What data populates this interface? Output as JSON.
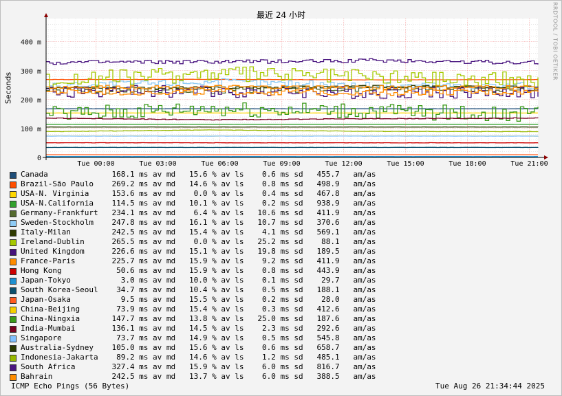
{
  "watermark": "RRDTOOL / TOBI OETIKER",
  "footer": {
    "probe": "ICMP Echo Pings (56 Bytes)",
    "timestamp": "Tue Aug 26 21:34:44 2025"
  },
  "colors": {
    "background": "#f3f3f3",
    "plot_background": "#ffffff",
    "major_grid": "#ff9b9b",
    "minor_grid": "#d0d0d0",
    "axis": "#000000",
    "arrow": "#8b0000"
  },
  "chart_data": {
    "type": "line",
    "title": "最近 24 小时",
    "ylabel": "Seconds",
    "ylim": [
      0,
      480
    ],
    "yticks": [
      {
        "value": 0,
        "label": "0"
      },
      {
        "value": 100,
        "label": "100 m"
      },
      {
        "value": 200,
        "label": "200 m"
      },
      {
        "value": 300,
        "label": "300 m"
      },
      {
        "value": 400,
        "label": "400 m"
      }
    ],
    "xlim": [
      "Mon 22:00",
      "Tue 21:40"
    ],
    "xticks": [
      {
        "value": "Tue 00:00",
        "label": "Tue 00:00"
      },
      {
        "value": "Tue 03:00",
        "label": "Tue 03:00"
      },
      {
        "value": "Tue 06:00",
        "label": "Tue 06:00"
      },
      {
        "value": "Tue 09:00",
        "label": "Tue 09:00"
      },
      {
        "value": "Tue 12:00",
        "label": "Tue 12:00"
      },
      {
        "value": "Tue 15:00",
        "label": "Tue 15:00"
      },
      {
        "value": "Tue 18:00",
        "label": "Tue 18:00"
      },
      {
        "value": "Tue 21:00",
        "label": "Tue 21:00"
      }
    ],
    "grid": true,
    "legend_placement": "bottom",
    "series": [
      {
        "name": "Canada",
        "color": "#1f4e79",
        "values_ms": [
          168.1,
          168.1,
          168.1,
          168.1
        ],
        "stats": {
          "median": "168.1 ms av md",
          "loss": "15.6 % av ls",
          "sd": "0.6 ms sd",
          "am": "455.7",
          "am_unit": "am/as"
        }
      },
      {
        "name": "Brazil-São Paulo",
        "color": "#ff4e00",
        "values_ms": [
          269.2,
          270,
          268,
          269.2
        ],
        "stats": {
          "median": "269.2 ms av md",
          "loss": "14.6 % av ls",
          "sd": "0.8 ms sd",
          "am": "498.9",
          "am_unit": "am/as"
        }
      },
      {
        "name": "USA-N. Virginia",
        "color": "#ffd700",
        "values_ms": [
          153.6,
          153.6,
          153.6,
          153.6
        ],
        "stats": {
          "median": "153.6 ms av md",
          "loss": "0.0 % av ls",
          "sd": "0.4 ms sd",
          "am": "467.8",
          "am_unit": "am/as"
        }
      },
      {
        "name": "USA-N.California",
        "color": "#32a02d",
        "values_ms": [
          114.5,
          114.5,
          114.5,
          114.5
        ],
        "stats": {
          "median": "114.5 ms av md",
          "loss": "10.1 % av ls",
          "sd": "0.2 ms sd",
          "am": "938.9",
          "am_unit": "am/as"
        }
      },
      {
        "name": "Germany-Frankfurt",
        "color": "#556b2f",
        "values_ms": [
          234.1,
          232,
          240,
          234.1
        ],
        "stats": {
          "median": "234.1 ms av md",
          "loss": "6.4 % av ls",
          "sd": "10.6 ms sd",
          "am": "411.9",
          "am_unit": "am/as"
        }
      },
      {
        "name": "Sweden-Stockholm",
        "color": "#8ecbf5",
        "values_ms": [
          247.8,
          262,
          250,
          247.8
        ],
        "stats": {
          "median": "247.8 ms av md",
          "loss": "16.1 % av ls",
          "sd": "10.7 ms sd",
          "am": "370.6",
          "am_unit": "am/as"
        }
      },
      {
        "name": "Italy-Milan",
        "color": "#2f3a00",
        "values_ms": [
          242.5,
          240,
          245,
          242.5
        ],
        "stats": {
          "median": "242.5 ms av md",
          "loss": "15.4 % av ls",
          "sd": "4.1 ms sd",
          "am": "569.1",
          "am_unit": "am/as"
        }
      },
      {
        "name": "Ireland-Dublin",
        "color": "#a5c800",
        "values_ms": [
          265.5,
          290,
          280,
          265.5
        ],
        "stats": {
          "median": "265.5 ms av md",
          "loss": "0.0 % av ls",
          "sd": "25.2 ms sd",
          "am": "88.1",
          "am_unit": "am/as"
        }
      },
      {
        "name": "United Kingdom",
        "color": "#46127a",
        "values_ms": [
          226.6,
          230,
          225,
          226.6
        ],
        "stats": {
          "median": "226.6 ms av md",
          "loss": "15.1 % av ls",
          "sd": "19.8 ms sd",
          "am": "189.5",
          "am_unit": "am/as"
        }
      },
      {
        "name": "France-Paris",
        "color": "#ff8c00",
        "values_ms": [
          225.7,
          226,
          224,
          225.7
        ],
        "stats": {
          "median": "225.7 ms av md",
          "loss": "15.9 % av ls",
          "sd": "9.2 ms sd",
          "am": "411.9",
          "am_unit": "am/as"
        }
      },
      {
        "name": "Hong Kong",
        "color": "#cc0000",
        "values_ms": [
          50.6,
          50.6,
          50.6,
          50.6
        ],
        "stats": {
          "median": "50.6 ms av md",
          "loss": "15.9 % av ls",
          "sd": "0.8 ms sd",
          "am": "443.9",
          "am_unit": "am/as"
        }
      },
      {
        "name": "Japan-Tokyo",
        "color": "#1e90d0",
        "values_ms": [
          3.0,
          3.0,
          3.0,
          3.0
        ],
        "stats": {
          "median": "3.0 ms av md",
          "loss": "10.0 % av ls",
          "sd": "0.1 ms sd",
          "am": "29.7",
          "am_unit": "am/as"
        }
      },
      {
        "name": "South Korea-Seoul",
        "color": "#0b4f6c",
        "values_ms": [
          34.7,
          34.7,
          34.7,
          34.7
        ],
        "stats": {
          "median": "34.7 ms av md",
          "loss": "10.4 % av ls",
          "sd": "0.5 ms sd",
          "am": "188.1",
          "am_unit": "am/as"
        }
      },
      {
        "name": "Japan-Osaka",
        "color": "#ff5a1f",
        "values_ms": [
          9.5,
          9.5,
          9.5,
          9.5
        ],
        "stats": {
          "median": "9.5 ms av md",
          "loss": "15.5 % av ls",
          "sd": "0.2 ms sd",
          "am": "28.0",
          "am_unit": "am/as"
        }
      },
      {
        "name": "China-Beijing",
        "color": "#f5d000",
        "values_ms": [
          73.9,
          73.9,
          73.9,
          73.9
        ],
        "stats": {
          "median": "73.9 ms av md",
          "loss": "15.4 % av ls",
          "sd": "0.3 ms sd",
          "am": "412.6",
          "am_unit": "am/as"
        }
      },
      {
        "name": "China-Ningxia",
        "color": "#3a9a1a",
        "values_ms": [
          147.7,
          170,
          160,
          147.7
        ],
        "stats": {
          "median": "147.7 ms av md",
          "loss": "13.8 % av ls",
          "sd": "25.0 ms sd",
          "am": "187.6",
          "am_unit": "am/as"
        }
      },
      {
        "name": "India-Mumbai",
        "color": "#7a0020",
        "values_ms": [
          136.1,
          130,
          134,
          136.1
        ],
        "stats": {
          "median": "136.1 ms av md",
          "loss": "14.5 % av ls",
          "sd": "2.3 ms sd",
          "am": "292.6",
          "am_unit": "am/as"
        }
      },
      {
        "name": "Singapore",
        "color": "#80c0ff",
        "values_ms": [
          73.7,
          73.7,
          73.7,
          73.7
        ],
        "stats": {
          "median": "73.7 ms av md",
          "loss": "14.9 % av ls",
          "sd": "0.5 ms sd",
          "am": "545.8",
          "am_unit": "am/as"
        }
      },
      {
        "name": "Australia-Sydney",
        "color": "#2b3a00",
        "values_ms": [
          105.0,
          105.0,
          105.0,
          105.0
        ],
        "stats": {
          "median": "105.0 ms av md",
          "loss": "15.6 % av ls",
          "sd": "0.6 ms sd",
          "am": "658.7",
          "am_unit": "am/as"
        }
      },
      {
        "name": "Indonesia-Jakarta",
        "color": "#98b800",
        "values_ms": [
          89.2,
          95,
          90,
          89.2
        ],
        "stats": {
          "median": "89.2 ms av md",
          "loss": "14.6 % av ls",
          "sd": "1.2 ms sd",
          "am": "485.1",
          "am_unit": "am/as"
        }
      },
      {
        "name": "South Africa",
        "color": "#4a1680",
        "values_ms": [
          327.4,
          330,
          335,
          327.4
        ],
        "stats": {
          "median": "327.4 ms av md",
          "loss": "15.9 % av ls",
          "sd": "6.0 ms sd",
          "am": "816.7",
          "am_unit": "am/as"
        }
      },
      {
        "name": "Bahrain",
        "color": "#ff8c00",
        "values_ms": [
          242.5,
          243,
          242,
          242.5
        ],
        "stats": {
          "median": "242.5 ms av md",
          "loss": "13.7 % av ls",
          "sd": "6.0 ms sd",
          "am": "388.5",
          "am_unit": "am/as"
        }
      }
    ]
  }
}
